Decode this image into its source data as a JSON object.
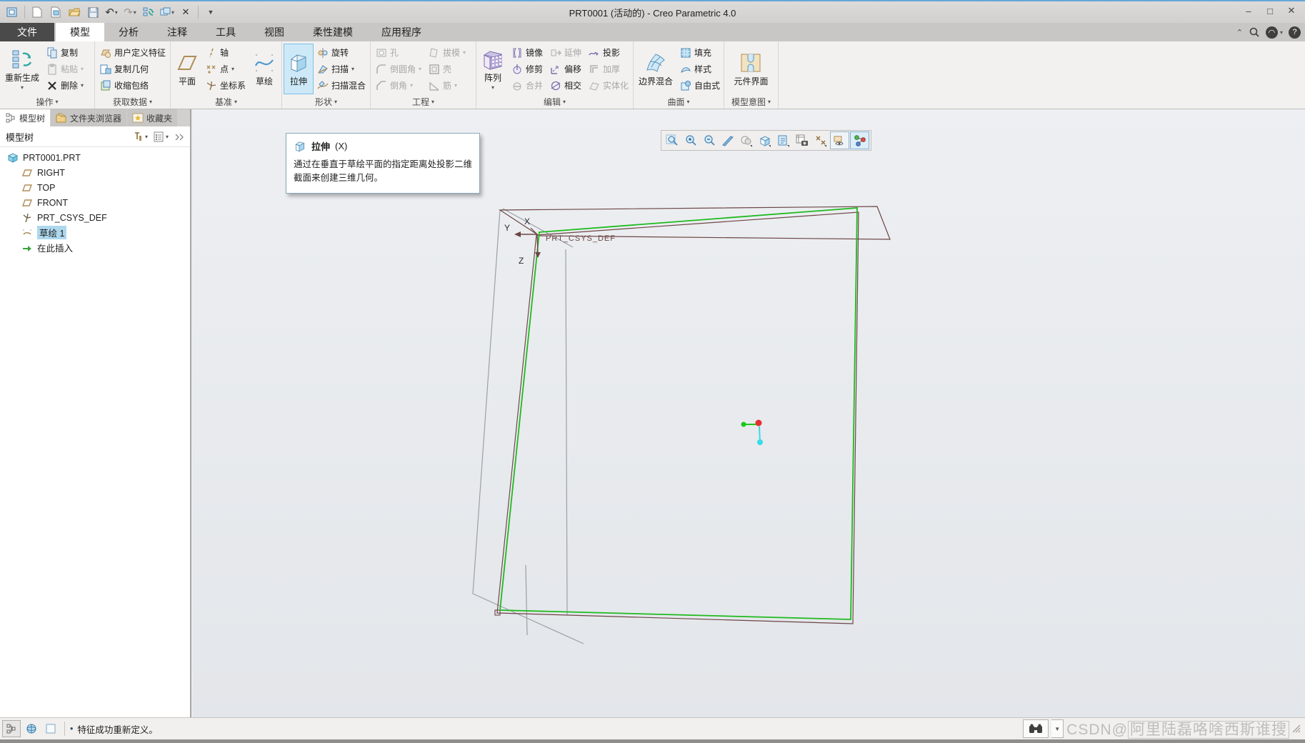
{
  "window": {
    "title": "PRT0001 (活动的) - Creo Parametric 4.0"
  },
  "quick_access_icons": [
    "window-menu",
    "new-file",
    "open-model",
    "open-folder",
    "save",
    "undo",
    "redo",
    "regenerate",
    "window-switch",
    "close-window",
    "customize-toolbar"
  ],
  "tabs": {
    "file": "文件",
    "items": [
      "模型",
      "分析",
      "注释",
      "工具",
      "视图",
      "柔性建模",
      "应用程序"
    ]
  },
  "ribbon": {
    "groups": [
      {
        "label": "操作",
        "big": "重新生成",
        "items": [
          "复制",
          "粘贴",
          "删除"
        ]
      },
      {
        "label": "获取数据",
        "items": [
          "用户定义特征",
          "复制几何",
          "收缩包络"
        ]
      },
      {
        "label": "基准",
        "big": "平面",
        "big2": "草绘",
        "items": [
          "轴",
          "点",
          "坐标系"
        ]
      },
      {
        "label": "形状",
        "big": "拉伸",
        "items": [
          "旋转",
          "扫描",
          "扫描混合"
        ]
      },
      {
        "label": "工程",
        "items": [
          "孔",
          "倒圆角",
          "倒角"
        ],
        "items2": [
          "拔模",
          "壳",
          "筋"
        ]
      },
      {
        "label": "编辑",
        "big": "阵列",
        "items": [
          "镜像",
          "修剪",
          "合并"
        ],
        "items2": [
          "延伸",
          "偏移",
          "相交"
        ],
        "items3": [
          "投影",
          "加厚",
          "实体化"
        ]
      },
      {
        "label": "曲面",
        "big": "边界混合",
        "items": [
          "填充",
          "样式",
          "自由式"
        ]
      },
      {
        "label": "模型意图",
        "big": "元件界面"
      }
    ]
  },
  "left_panel": {
    "tabs": [
      "模型树",
      "文件夹浏览器",
      "收藏夹"
    ],
    "header": "模型树",
    "tree": [
      "PRT0001.PRT",
      "RIGHT",
      "TOP",
      "FRONT",
      "PRT_CSYS_DEF",
      "草绘 1",
      "在此插入"
    ]
  },
  "tooltip": {
    "title": "拉伸",
    "shortcut": "(X)",
    "body": "通过在垂直于草绘平面的指定距离处投影二维截面来创建三维几何。"
  },
  "viewport": {
    "toolbar_icons": [
      "refit",
      "zoom-in",
      "zoom-out",
      "repaint",
      "shading-style",
      "display-style",
      "saved-orientations",
      "view-manager",
      "datum-display",
      "annotation-display",
      "spin-center"
    ],
    "csys_label": "PRT_CSYS_DEF",
    "axes": {
      "x": "X",
      "y": "Y",
      "z": "Z"
    },
    "colors": {
      "sketch": "#1fba1f",
      "plane_edge": "#9aa0a8",
      "highlight_edge": "#6d4545"
    }
  },
  "status_bar": {
    "message": "特征成功重新定义。",
    "watermark_prefix": "CSDN@",
    "watermark_boxed": "阿里陆磊咯啥西斯谁搜"
  }
}
